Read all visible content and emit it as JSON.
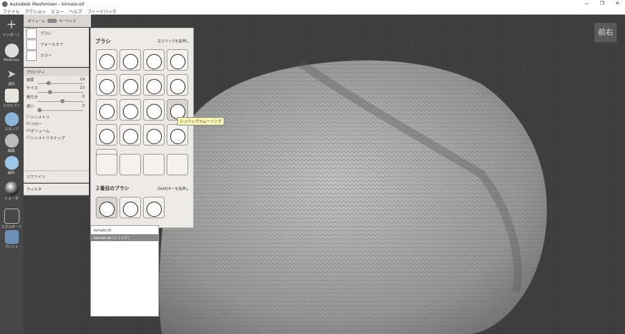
{
  "window": {
    "title": "Autodesk Meshmixer - tomato.stl",
    "buttons": [
      "—",
      "❐",
      "✕"
    ]
  },
  "menu": [
    "ファイル",
    "アクション",
    "ビュー",
    "ヘルプ",
    "フィードバック"
  ],
  "toolbar": [
    {
      "label": "インポート",
      "icon": "plus-icon"
    },
    {
      "label": "Meshmix",
      "icon": "meshmix-icon"
    },
    {
      "label": "選択",
      "icon": "select-icon"
    },
    {
      "label": "スカルプト",
      "icon": "sculpt-brush-icon",
      "active": true
    },
    {
      "label": "スタンプ",
      "icon": "stamp-icon"
    },
    {
      "label": "編集",
      "icon": "edit-icon"
    },
    {
      "label": "解析",
      "icon": "analysis-icon"
    },
    {
      "label": "シェーダ",
      "icon": "shader-icon"
    },
    {
      "label": "エクスポート",
      "icon": "export-icon"
    },
    {
      "label": "プリント",
      "icon": "print-icon"
    }
  ],
  "mode": {
    "volume": "ボリューム",
    "surface": "サーフェス"
  },
  "sections": {
    "brush": "ブラシ",
    "falloff": "フォールオフ",
    "color": "カラー"
  },
  "properties": {
    "header": "プロパティ",
    "strength": {
      "label": "強度",
      "value": "19",
      "level": 0.19
    },
    "size": {
      "label": "サイズ",
      "value": "23",
      "level": 0.23
    },
    "depth": {
      "label": "奥行き",
      "value": "0",
      "level": 0.5
    },
    "lazy": {
      "label": "遅い",
      "value": "0",
      "level": 0.0
    },
    "checks": [
      {
        "label": "シンメトリ",
        "checked": false
      },
      {
        "label": "フロー",
        "checked": true
      },
      {
        "label": "ボリューム",
        "checked": true
      },
      {
        "label": "シンメトリスナップ",
        "checked": false
      }
    ]
  },
  "refine": "リファイン",
  "filter": "フィルタ",
  "brush_panel": {
    "title": "ブラシ",
    "hint": "左クリックを長押し",
    "secondary_title": "２番目のブラシ",
    "secondary_hint": "[Shift]キーを長押し",
    "tooltip": "シュリンクスムージング"
  },
  "objects": {
    "items": [
      {
        "name": "tomato.stl",
        "selected": false
      },
      {
        "name": "tomato.stl (ソリッド)",
        "selected": true
      }
    ]
  },
  "viewcube": {
    "front": "前",
    "right": "右"
  }
}
